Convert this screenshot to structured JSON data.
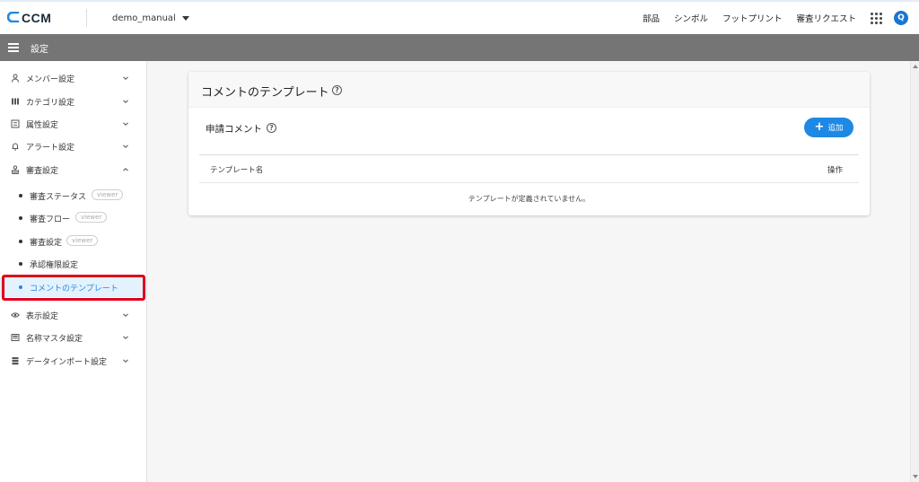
{
  "header": {
    "logo_text": "CCM",
    "project_name": "demo_manual",
    "nav": [
      "部品",
      "シンボル",
      "フットプリント",
      "審査リクエスト"
    ],
    "avatar_letter": "Q"
  },
  "titlebar": {
    "label": "設定"
  },
  "sidebar": {
    "items": [
      {
        "label": "メンバー設定",
        "icon": "user-icon",
        "expanded": false
      },
      {
        "label": "カテゴリ設定",
        "icon": "category-icon",
        "expanded": false
      },
      {
        "label": "属性設定",
        "icon": "attribute-icon",
        "expanded": false
      },
      {
        "label": "アラート設定",
        "icon": "bell-icon",
        "expanded": false
      },
      {
        "label": "審査設定",
        "icon": "stamp-icon",
        "expanded": true
      },
      {
        "label": "表示設定",
        "icon": "eye-icon",
        "expanded": false
      },
      {
        "label": "名称マスタ設定",
        "icon": "master-icon",
        "expanded": false
      },
      {
        "label": "データインポート設定",
        "icon": "import-icon",
        "expanded": false
      }
    ],
    "review_subitems": [
      {
        "label": "審査ステータス",
        "badge": "viewer"
      },
      {
        "label": "審査フロー",
        "badge": "viewer"
      },
      {
        "label": "審査設定",
        "badge": "viewer"
      },
      {
        "label": "承認権限設定",
        "badge": ""
      },
      {
        "label": "コメントのテンプレート",
        "badge": "",
        "active": true
      }
    ]
  },
  "main": {
    "card_title": "コメントのテンプレート",
    "section_title": "申請コメント",
    "add_button": "追加",
    "columns": [
      "テンプレート名",
      "操作"
    ],
    "empty_message": "テンプレートが定義されていません。"
  },
  "colors": {
    "accent": "#1e88e5",
    "titlebar": "#757575",
    "highlight": "#e0001a",
    "active_bg": "#e3f2fd"
  }
}
